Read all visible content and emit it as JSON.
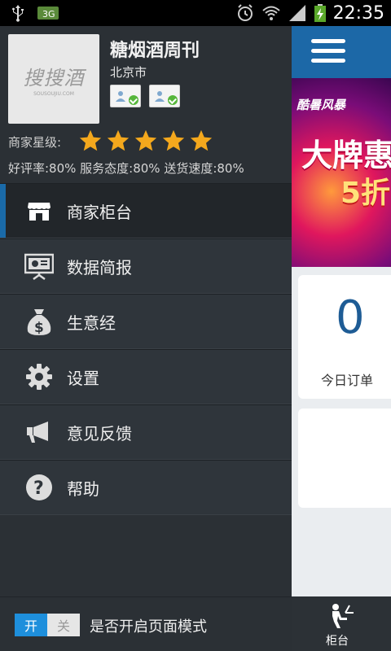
{
  "status_bar": {
    "time": "22:35",
    "icons": [
      "usb-icon",
      "sim-icon",
      "alarm-icon",
      "wifi-icon",
      "signal-icon",
      "battery-charging-icon"
    ]
  },
  "drawer": {
    "logo_text": "搜搜酒",
    "logo_sub": "SOUSOUJIU.COM",
    "shop_name": "糖烟酒周刊",
    "city": "北京市",
    "badges": [
      "id-verified-icon",
      "license-verified-icon"
    ],
    "rating_label": "商家星级:",
    "stars": 5,
    "scores": "好评率:80%  服务态度:80% 送货速度:80%",
    "menu": [
      {
        "label": "商家柜台",
        "icon": "store-icon",
        "active": true
      },
      {
        "label": "数据简报",
        "icon": "presentation-icon",
        "active": false
      },
      {
        "label": "生意经",
        "icon": "money-bag-icon",
        "active": false
      },
      {
        "label": "设置",
        "icon": "gear-icon",
        "active": false
      },
      {
        "label": "意见反馈",
        "icon": "megaphone-icon",
        "active": false
      },
      {
        "label": "帮助",
        "icon": "help-icon",
        "active": false
      }
    ],
    "toggle": {
      "on_label": "开",
      "off_label": "关",
      "label": "是否开启页面模式"
    }
  },
  "main": {
    "banner": {
      "line1": "酷暑风暴",
      "line2": "大牌惠",
      "line3": "5折"
    },
    "today_orders": {
      "value": "0",
      "label": "今日订单"
    },
    "bottom_nav": {
      "label": "柜台"
    }
  },
  "colors": {
    "accent": "#1c68a7",
    "drawer_bg": "#2b3035",
    "star": "#f4a81d",
    "toggle_on": "#1e8fdc"
  }
}
